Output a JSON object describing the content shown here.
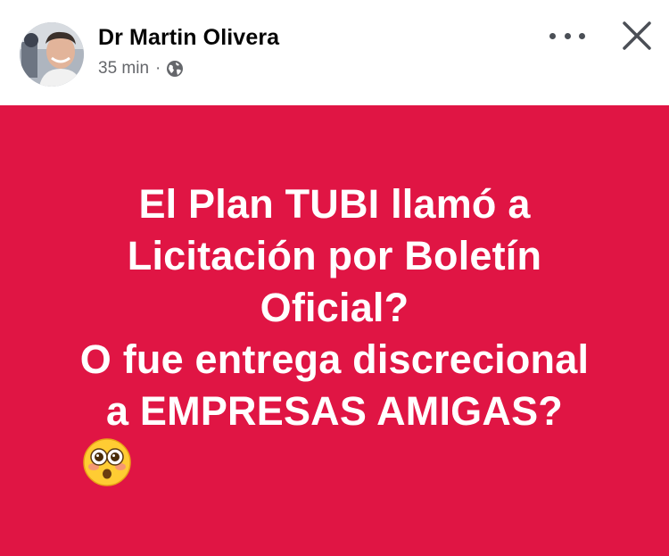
{
  "post": {
    "author": "Dr Martin Olivera",
    "time": "35 min",
    "separator": "·",
    "audience_icon": "globe-icon",
    "more_icon": "more-options-icon",
    "close_icon": "close-icon"
  },
  "card": {
    "background_color": "#e01544",
    "text_color": "#ffffff",
    "lines": [
      "El Plan TUBI llamó a",
      "Licitación por Boletín",
      "Oficial?",
      "O fue entrega discrecional",
      "a EMPRESAS AMIGAS?"
    ],
    "emoji": "flushed-face-emoji"
  }
}
